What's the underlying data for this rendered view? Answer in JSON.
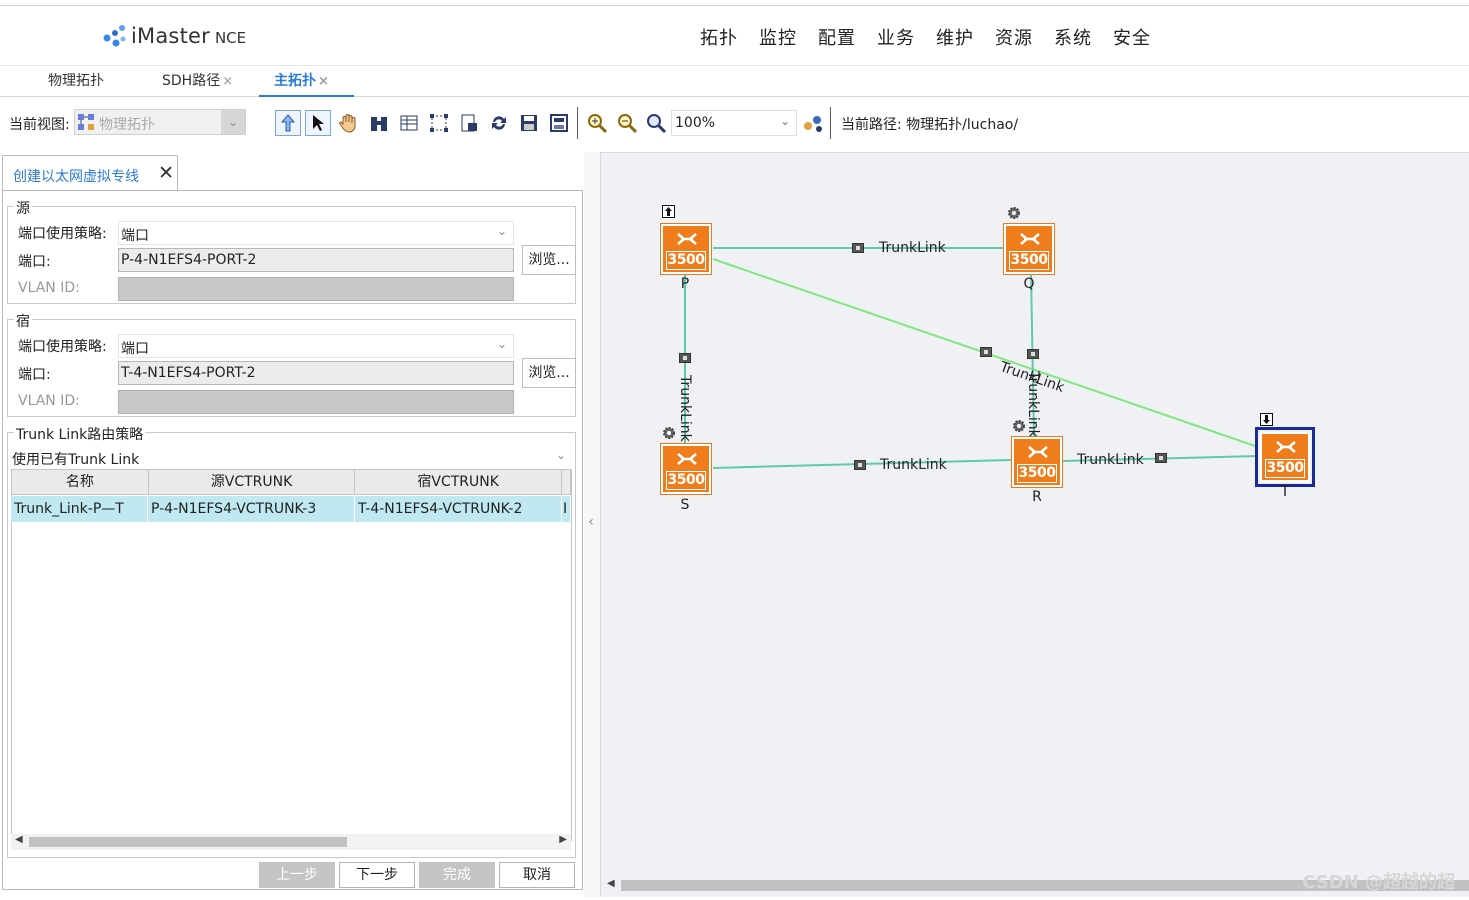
{
  "app": {
    "logo_text": "iMaster",
    "logo_sub": "NCE"
  },
  "nav": [
    "拓扑",
    "监控",
    "配置",
    "业务",
    "维护",
    "资源",
    "系统",
    "安全"
  ],
  "tabs": [
    {
      "label": "物理拓扑",
      "closable": false
    },
    {
      "label": "SDH路径",
      "closable": true
    },
    {
      "label": "主拓扑",
      "closable": true,
      "active": true
    }
  ],
  "toolbar": {
    "view_label": "当前视图:",
    "view_value": "物理拓扑",
    "zoom_value": "100%",
    "path_label": "当前路径: 物理拓扑/luchao/"
  },
  "panel": {
    "tab_label": "创建以太网虚拟专线",
    "source": {
      "title": "源",
      "policy_label": "端口使用策略:",
      "policy_value": "端口",
      "port_label": "端口:",
      "port_value": "P-4-N1EFS4-PORT-2",
      "browse_label": "浏览...",
      "vlan_label": "VLAN ID:"
    },
    "sink": {
      "title": "宿",
      "policy_label": "端口使用策略:",
      "policy_value": "端口",
      "port_label": "端口:",
      "port_value": "T-4-N1EFS4-PORT-2",
      "browse_label": "浏览...",
      "vlan_label": "VLAN ID:"
    },
    "trunk": {
      "title": "Trunk Link路由策略",
      "policy_value": "使用已有Trunk Link",
      "columns": [
        "名称",
        "源VCTRUNK",
        "宿VCTRUNK"
      ],
      "rows": [
        {
          "name": "Trunk_Link-P—T",
          "src": "P-4-N1EFS4-VCTRUNK-3",
          "dst": "T-4-N1EFS4-VCTRUNK-2",
          "extra": "I"
        }
      ]
    },
    "buttons": {
      "prev": "上一步",
      "next": "下一步",
      "finish": "完成",
      "cancel": "取消"
    }
  },
  "topology": {
    "nodes": [
      {
        "id": "P",
        "tag": "3500"
      },
      {
        "id": "Q",
        "tag": "3500"
      },
      {
        "id": "S",
        "tag": "3500"
      },
      {
        "id": "R",
        "tag": "3500"
      },
      {
        "id": "T",
        "tag": "3500",
        "selected": true
      }
    ],
    "link_label": "TrunkLink",
    "colors": {
      "link_trunk": "#5fc9a8",
      "link_highlight": "#7ee87e",
      "node_fill": "#ef7d1c",
      "selected_outline": "#1a2a9a"
    }
  },
  "watermark": "CSDN @超越的超"
}
